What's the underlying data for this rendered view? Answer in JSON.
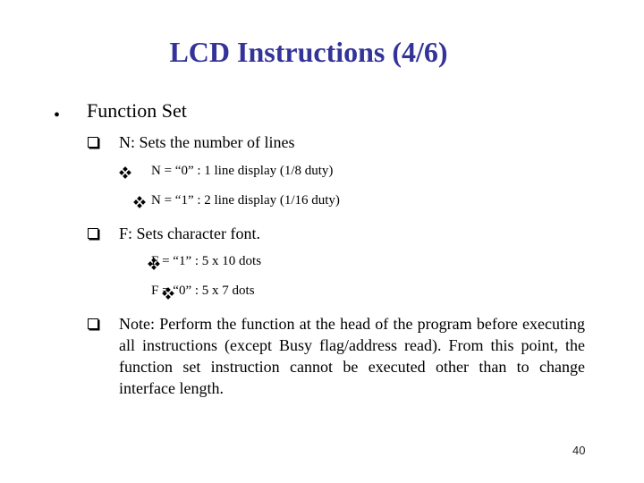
{
  "slide": {
    "title": "LCD Instructions (4/6)",
    "heading": "Function Set",
    "sections": [
      {
        "label": "N: Sets the number of lines",
        "items": [
          "N = “0” : 1 line display (1/8 duty)",
          "N = “1” : 2 line display (1/16 duty)"
        ]
      },
      {
        "label": "F: Sets character font.",
        "items": [
          "F = “1” : 5 x 10 dots",
          "F = “0” : 5 x 7 dots"
        ]
      }
    ],
    "note": "Note: Perform the function at the head of the program before executing all instructions (except Busy flag/address read). From this point, the function set instruction cannot be executed other than to change interface length.",
    "page_number": "40",
    "title_color": "#333399"
  }
}
